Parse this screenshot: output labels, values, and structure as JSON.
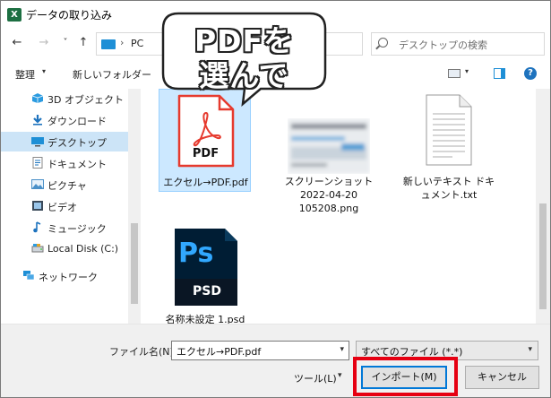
{
  "window": {
    "title": "データの取り込み"
  },
  "nav": {
    "back": "←",
    "forward": "→",
    "recent": "˅",
    "up": "↑",
    "address_sep": "›",
    "address_location": "PC",
    "search_placeholder": "デスクトップの検索"
  },
  "toolbar": {
    "organize": "整理",
    "organize_caret": "▾",
    "new_folder": "新しいフォルダー",
    "view_caret": "▾",
    "help": "?"
  },
  "sidebar": {
    "items": [
      {
        "label": "3D オブジェクト",
        "icon": "3d-objects-icon"
      },
      {
        "label": "ダウンロード",
        "icon": "download-icon"
      },
      {
        "label": "デスクトップ",
        "icon": "desktop-icon",
        "selected": true
      },
      {
        "label": "ドキュメント",
        "icon": "documents-icon"
      },
      {
        "label": "ピクチャ",
        "icon": "pictures-icon"
      },
      {
        "label": "ビデオ",
        "icon": "videos-icon"
      },
      {
        "label": "ミュージック",
        "icon": "music-icon"
      },
      {
        "label": "Local Disk (C:)",
        "icon": "disk-icon"
      },
      {
        "label": "ネットワーク",
        "icon": "network-icon"
      }
    ]
  },
  "files": [
    {
      "name": "エクセル→PDF.pdf",
      "icon": "pdf-file-icon",
      "icon_label": "PDF",
      "selected": true
    },
    {
      "name": "スクリーンショット 2022-04-20 105208.png",
      "icon": "image-thumbnail-icon"
    },
    {
      "name": "新しいテキスト ドキュメント.txt",
      "icon": "text-file-icon"
    },
    {
      "name": "名称未設定 1.psd",
      "icon": "photoshop-file-icon",
      "icon_label": "Ps",
      "icon_sub": "PSD"
    }
  ],
  "footer": {
    "filename_label": "ファイル名(N):",
    "filename_value": "エクセル→PDF.pdf",
    "filter_value": "すべてのファイル (*.*)",
    "tools": "ツール(L)",
    "import": "インポート(M)",
    "cancel": "キャンセル",
    "caret": "▾"
  },
  "callout": {
    "line1": "PDFを",
    "line2": "選んで"
  },
  "colors": {
    "selection": "#cce8ff",
    "highlight_red": "#e60012",
    "accent_blue": "#0078d7"
  }
}
